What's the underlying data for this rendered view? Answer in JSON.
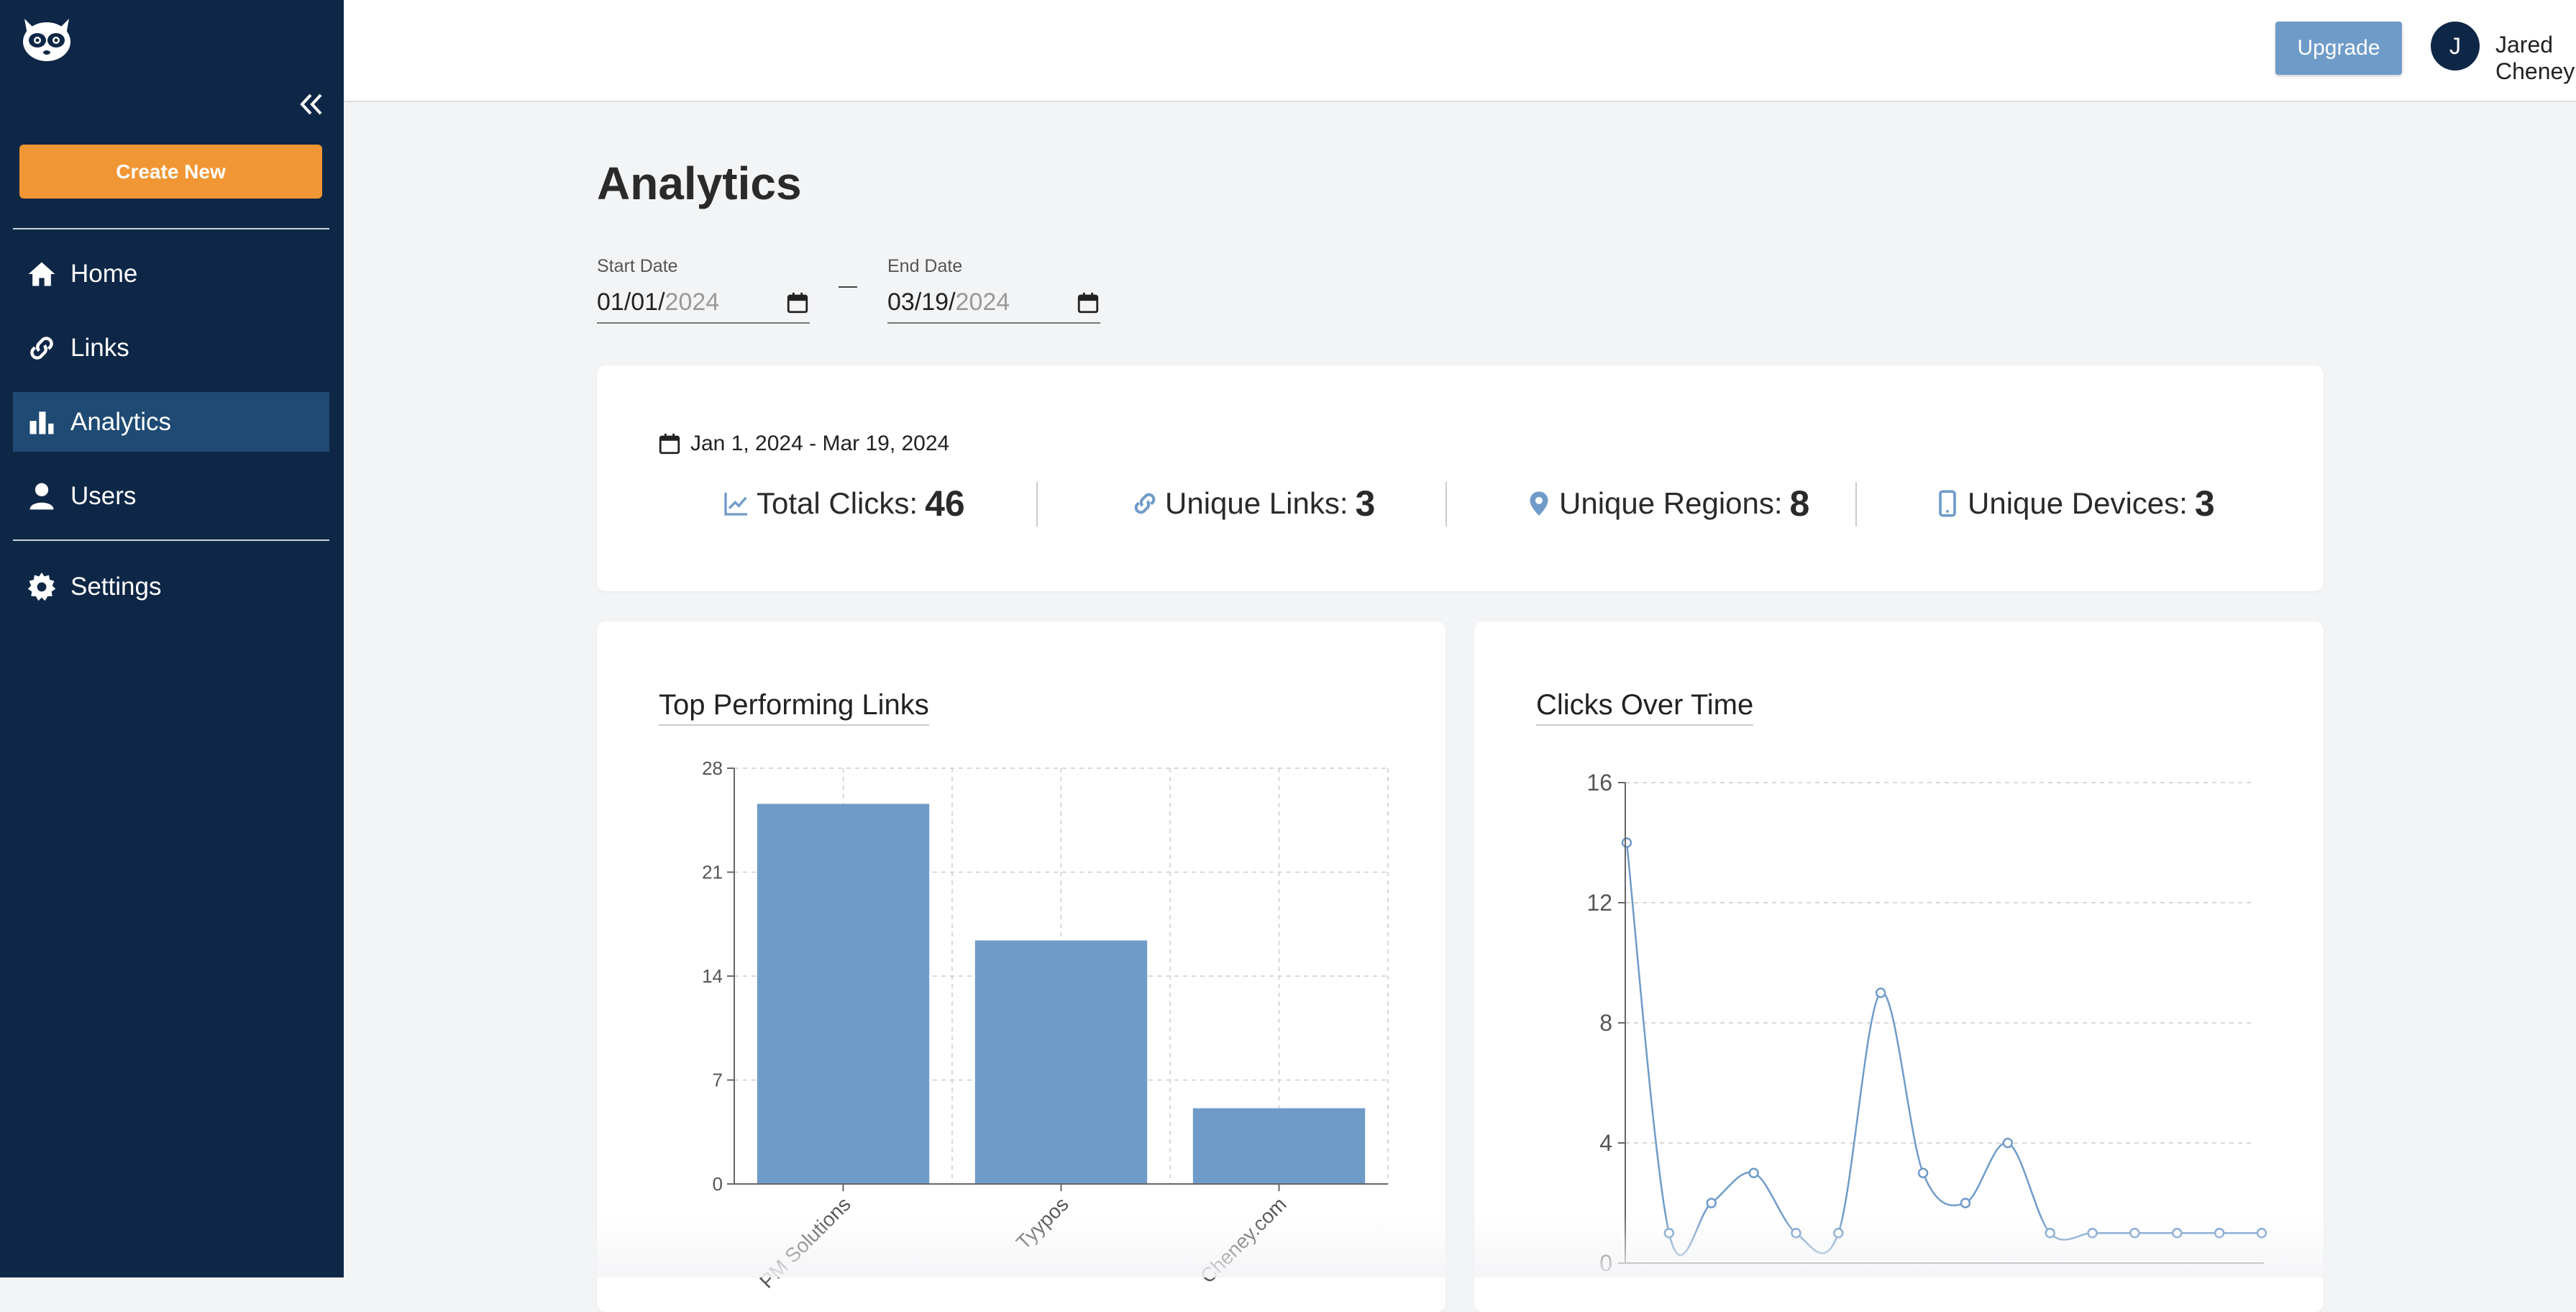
{
  "sidebar": {
    "create_label": "Create New",
    "items": [
      {
        "label": "Home",
        "icon": "home-icon"
      },
      {
        "label": "Links",
        "icon": "link-icon"
      },
      {
        "label": "Analytics",
        "icon": "bar-chart-icon",
        "active": true
      },
      {
        "label": "Users",
        "icon": "user-icon"
      },
      {
        "label": "Settings",
        "icon": "gear-icon"
      }
    ]
  },
  "topbar": {
    "upgrade_label": "Upgrade",
    "avatar_initial": "J",
    "user_name": "Jared Cheney"
  },
  "page": {
    "title": "Analytics",
    "start_label": "Start Date",
    "start_value": "01/01/",
    "start_year": "2024",
    "end_label": "End Date",
    "end_value": "03/19/",
    "end_year": "2024"
  },
  "summary": {
    "range": "Jan 1, 2024 - Mar 19, 2024",
    "total_clicks_label": "Total Clicks:",
    "total_clicks": "46",
    "unique_links_label": "Unique Links:",
    "unique_links": "3",
    "unique_regions_label": "Unique Regions:",
    "unique_regions": "8",
    "unique_devices_label": "Unique Devices:",
    "unique_devices": "3"
  },
  "colors": {
    "sidebar_bg": "#0f2746",
    "accent_orange": "#f19634",
    "bar_blue": "#6f9bc9",
    "active_nav": "#1e4a73"
  },
  "chart_data": [
    {
      "type": "bar",
      "title": "Top Performing Links",
      "categories": [
        "PM Solutions",
        "Tyypos",
        "Cheney.com"
      ],
      "values": [
        25.6,
        16.4,
        5.1
      ],
      "ylim": [
        0,
        28
      ],
      "yticks": [
        "0",
        "7",
        "14",
        "21",
        "28"
      ],
      "grid": true
    },
    {
      "type": "line",
      "title": "Clicks Over Time",
      "y": [
        14,
        1,
        2,
        3,
        1,
        1,
        9,
        3,
        2,
        4,
        1,
        1,
        1,
        1,
        1,
        1
      ],
      "ylim": [
        0,
        16
      ],
      "yticks": [
        "0",
        "4",
        "8",
        "12",
        "16"
      ],
      "grid": true
    }
  ]
}
